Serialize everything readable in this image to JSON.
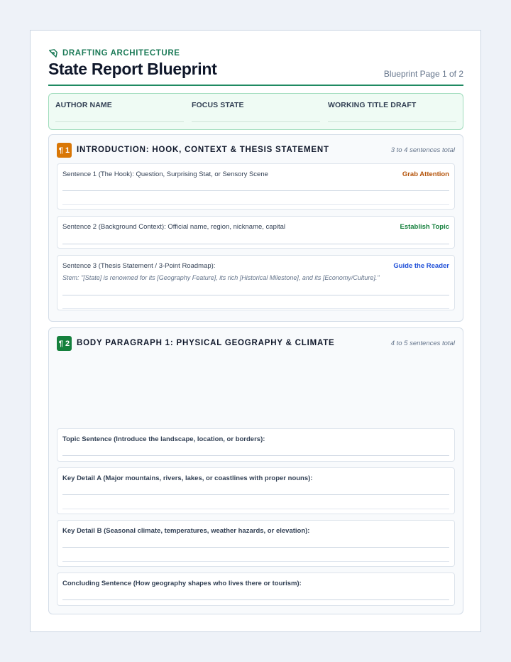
{
  "header": {
    "eyebrow": "DRAFTING ARCHITECTURE",
    "title": "State Report Blueprint",
    "page_label": "Blueprint Page 1 of 2"
  },
  "meta": {
    "author_label": "AUTHOR NAME",
    "state_label": "FOCUS STATE",
    "title_label": "WORKING TITLE DRAFT"
  },
  "colors": {
    "accent_green": "#1f8a62",
    "orange": "#d97706",
    "blue": "#1d4ed8"
  },
  "intro": {
    "badge": "¶ 1",
    "title": "INTRODUCTION: HOOK, CONTEXT & THESIS STATEMENT",
    "note": "3 to 4 sentences total",
    "s1_label": "Sentence 1 (The Hook): Question, Surprising Stat, or Sensory Scene",
    "s1_tag": "Grab Attention",
    "s2_label": "Sentence 2 (Background Context): Official name, region, nickname, capital",
    "s2_tag": "Establish Topic",
    "s3_label": "Sentence 3 (Thesis Statement / 3-Point Roadmap):",
    "s3_tag": "Guide the Reader",
    "s3_stem": "Stem: \"[State] is renowned for its [Geography Feature], its rich [Historical Milestone], and its [Economy/Culture].\""
  },
  "body1": {
    "badge": "¶ 2",
    "title": "BODY PARAGRAPH 1: PHYSICAL GEOGRAPHY & CLIMATE",
    "note": "4 to 5 sentences total",
    "topic_label": "Topic Sentence (Introduce the landscape, location, or borders):",
    "detail_a_label": "Key Detail A (Major mountains, rivers, lakes, or coastlines with proper nouns):",
    "detail_b_label": "Key Detail B (Seasonal climate, temperatures, weather hazards, or elevation):",
    "concluding_label": "Concluding Sentence (How geography shapes who lives there or tourism):"
  }
}
